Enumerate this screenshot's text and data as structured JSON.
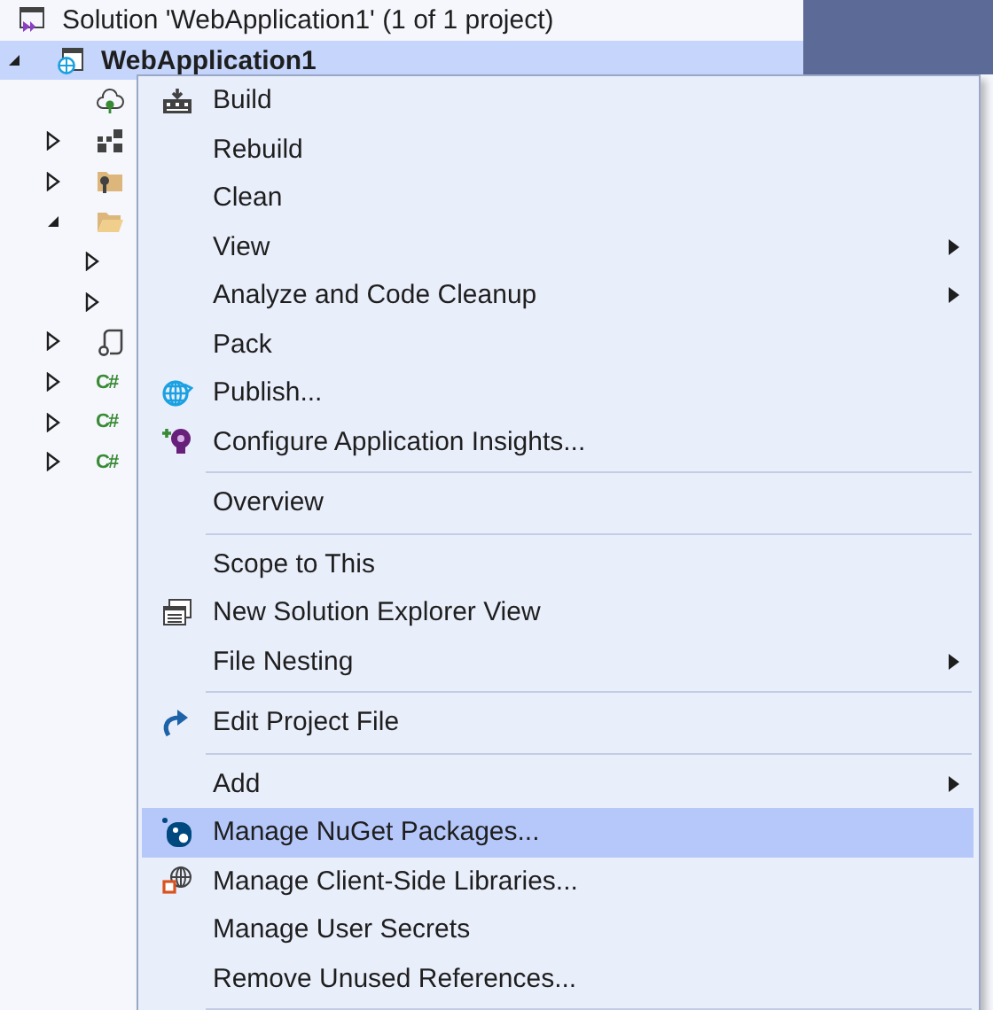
{
  "solution_explorer": {
    "items": [
      {
        "label": "Solution 'WebApplication1' (1 of 1 project)",
        "kind": "solution",
        "selected": false,
        "children": [
          {
            "label": "WebApplication1",
            "kind": "project",
            "expanded": true,
            "selected": true,
            "children": [
              {
                "kind": "cloud",
                "selected": false
              },
              {
                "kind": "deps",
                "expanded": false,
                "selected": false
              },
              {
                "kind": "props",
                "expanded": false,
                "selected": false
              },
              {
                "kind": "folder",
                "expanded": true,
                "selected": false,
                "children": [
                  {
                    "expanded": false,
                    "selected": false
                  },
                  {
                    "expanded": false,
                    "selected": false
                  }
                ]
              },
              {
                "kind": "route",
                "expanded": false,
                "selected": false
              },
              {
                "kind": "csharp",
                "icon_text": "C#",
                "expanded": false,
                "selected": false
              },
              {
                "kind": "csharp",
                "icon_text": "C#",
                "expanded": false,
                "selected": false
              },
              {
                "kind": "csharp",
                "icon_text": "C#",
                "expanded": false,
                "selected": false
              }
            ]
          }
        ]
      }
    ]
  },
  "context_menu": {
    "items": [
      {
        "kind": "command",
        "label": "Build",
        "submenu": false,
        "selected": false
      },
      {
        "kind": "command",
        "label": "Rebuild",
        "submenu": false,
        "selected": false
      },
      {
        "kind": "command",
        "label": "Clean",
        "submenu": false,
        "selected": false
      },
      {
        "kind": "command",
        "label": "View",
        "submenu": true,
        "selected": false
      },
      {
        "kind": "command",
        "label": "Analyze and Code Cleanup",
        "submenu": true,
        "selected": false
      },
      {
        "kind": "command",
        "label": "Pack",
        "submenu": false,
        "selected": false
      },
      {
        "kind": "command",
        "label": "Publish...",
        "submenu": false,
        "selected": false
      },
      {
        "kind": "command",
        "label": "Configure Application Insights...",
        "submenu": false,
        "selected": false
      },
      {
        "kind": "separator"
      },
      {
        "kind": "command",
        "label": "Overview",
        "submenu": false,
        "selected": false
      },
      {
        "kind": "separator"
      },
      {
        "kind": "command",
        "label": "Scope to This",
        "submenu": false,
        "selected": false
      },
      {
        "kind": "command",
        "label": "New Solution Explorer View",
        "submenu": false,
        "selected": false
      },
      {
        "kind": "command",
        "label": "File Nesting",
        "submenu": true,
        "selected": false
      },
      {
        "kind": "separator"
      },
      {
        "kind": "command",
        "label": "Edit Project File",
        "submenu": false,
        "selected": false
      },
      {
        "kind": "separator"
      },
      {
        "kind": "command",
        "label": "Add",
        "submenu": true,
        "selected": false
      },
      {
        "kind": "command",
        "label": "Manage NuGet Packages...",
        "submenu": false,
        "selected": true
      },
      {
        "kind": "command",
        "label": "Manage Client-Side Libraries...",
        "submenu": false,
        "selected": false
      },
      {
        "kind": "command",
        "label": "Manage User Secrets",
        "submenu": false,
        "selected": false
      },
      {
        "kind": "command",
        "label": "Remove Unused References...",
        "submenu": false,
        "selected": false
      },
      {
        "kind": "separator"
      }
    ]
  }
}
